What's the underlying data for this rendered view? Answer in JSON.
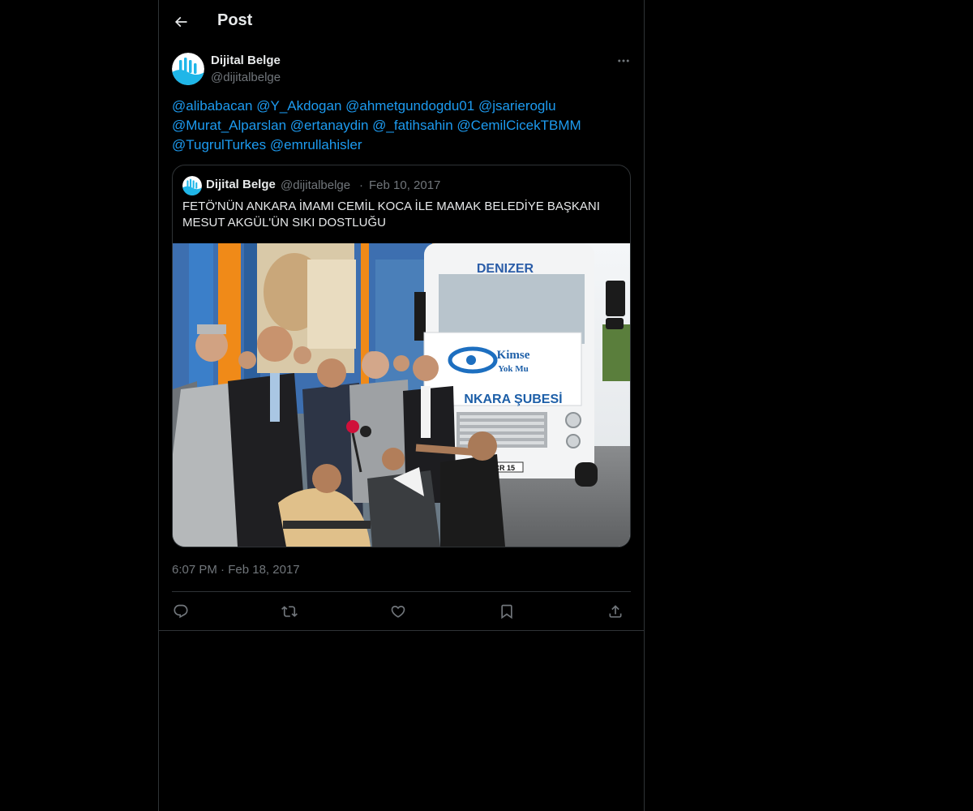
{
  "header": {
    "title": "Post",
    "back_icon": "arrow-left-icon"
  },
  "post": {
    "author_name": "Dijital Belge",
    "author_handle": "@dijitalbelge",
    "more_icon": "more-horizontal-icon",
    "mentions": [
      "@alibabacan",
      "@Y_Akdogan",
      "@ahmetgundogdu01",
      "@jsarieroglu",
      "@Murat_Alparslan",
      "@ertanaydin",
      "@_fatihsahin",
      "@CemilCicekTBMM",
      "@TugrulTurkes",
      "@emrullahisler"
    ],
    "time": "6:07 PM",
    "separator": "·",
    "date": "Feb 18, 2017"
  },
  "quote": {
    "author_name": "Dijital Belge",
    "author_handle": "@dijitalbelge",
    "separator": "·",
    "date": "Feb 10, 2017",
    "text": "FETÖ'NÜN ANKARA İMAMI CEMİL KOCA İLE MAMAK BELEDİYE BAŞKANI MESUT AKGÜL'ÜN SIKI DOSTLUĞU",
    "image": {
      "truck_brand": "DENIZER",
      "banner_line1": "Kimse",
      "banner_line2": "Yok Mu",
      "banner_line3": "NKARA ŞUBESİ",
      "plate": "BCR 15"
    }
  },
  "actions": {
    "reply_icon": "reply-icon",
    "repost_icon": "repost-icon",
    "like_icon": "heart-icon",
    "bookmark_icon": "bookmark-icon",
    "share_icon": "share-icon"
  },
  "colors": {
    "accent": "#1d9bf0",
    "muted": "#71767b",
    "border": "#2f3336",
    "background": "#000000",
    "text": "#e7e9ea"
  }
}
